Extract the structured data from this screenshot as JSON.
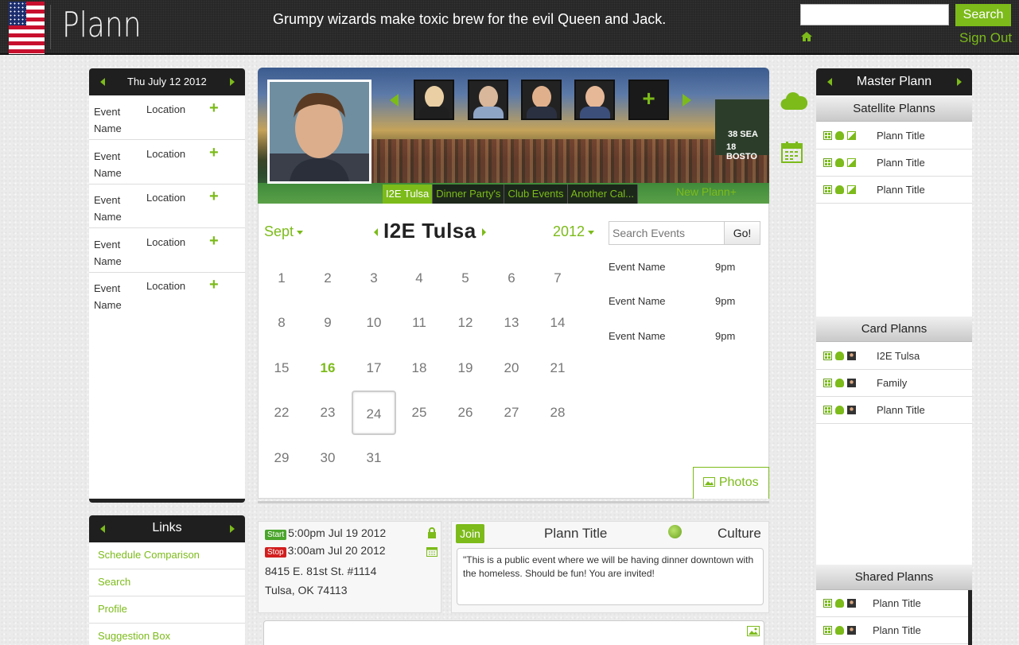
{
  "header": {
    "logo": "Plann",
    "tagline": "Grumpy wizards make toxic brew for the evil Queen and Jack.",
    "search_placeholder": "",
    "search_button": "Search",
    "sign_out": "Sign Out"
  },
  "left_panel": {
    "date": "Thu July 12 2012",
    "events": [
      {
        "name": "Event Name",
        "location": "Location"
      },
      {
        "name": "Event Name",
        "location": "Location"
      },
      {
        "name": "Event Name",
        "location": "Location"
      },
      {
        "name": "Event Name",
        "location": "Location"
      },
      {
        "name": "Event Name",
        "location": "Location"
      }
    ],
    "add_symbol": "+"
  },
  "links": {
    "title": "Links",
    "items": [
      "Schedule Comparison",
      "Search",
      "Profile",
      "Suggestion Box"
    ]
  },
  "banner": {
    "tabs": [
      "I2E Tulsa",
      "Dinner Party's",
      "Club Events",
      "Another Cal..."
    ],
    "new_plann": "New Plann+",
    "add_symbol": "+",
    "scoreboard": [
      "38 SEA",
      "18 BOSTO"
    ]
  },
  "calendar": {
    "month": "Sept",
    "title": "I2E Tulsa",
    "year": "2012",
    "days": [
      "1",
      "2",
      "3",
      "4",
      "5",
      "6",
      "7",
      "8",
      "9",
      "10",
      "11",
      "12",
      "13",
      "14",
      "15",
      "16",
      "17",
      "18",
      "19",
      "20",
      "21",
      "22",
      "23",
      "24",
      "25",
      "26",
      "27",
      "28",
      "29",
      "30",
      "31"
    ],
    "highlight_day": "16",
    "selected_day": "24",
    "search_placeholder": "Search Events",
    "go_button": "Go!",
    "events": [
      {
        "name": "Event Name",
        "time": "9pm"
      },
      {
        "name": "Event Name",
        "time": "9pm"
      },
      {
        "name": "Event Name",
        "time": "9pm"
      }
    ],
    "photos_tab": "Photos"
  },
  "detail": {
    "start_badge": "Start",
    "start_time": "5:00pm  Jul  19  2012",
    "stop_badge": "Stop",
    "stop_time": "3:00am  Jul  20  2012",
    "address1": "8415 E. 81st St. #1114",
    "address2": "Tulsa, OK 74113",
    "join": "Join",
    "plann_title": "Plann Title",
    "category": "Culture",
    "description": "\"This is a public event where we will be having dinner downtown with the homeless. Should be fun! You are invited!"
  },
  "right_panel": {
    "title": "Master Plann",
    "satellite_header": "Satellite Planns",
    "satellite": [
      "Plann Title",
      "Plann Title",
      "Plann Title"
    ],
    "card_header": "Card Planns",
    "card": [
      "I2E Tulsa",
      "Family",
      "Plann Title"
    ],
    "shared_header": "Shared Planns",
    "shared": [
      "Plann Title",
      "Plann Title"
    ]
  },
  "colors": {
    "accent": "#7cbb1a",
    "header_bg": "#272727",
    "stop_red": "#d21e1e"
  }
}
